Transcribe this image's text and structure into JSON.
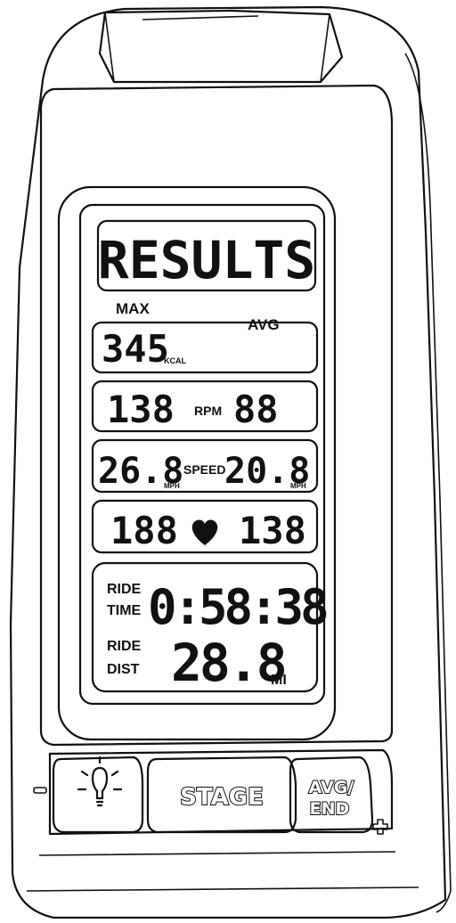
{
  "display": {
    "title": "RESULTS",
    "col_max": "MAX",
    "col_avg": "AVG",
    "calories": {
      "max": "345",
      "unit": "KCAL",
      "avg": ""
    },
    "rpm": {
      "max": "138",
      "label": "RPM",
      "avg": "88"
    },
    "speed": {
      "max": "26.8",
      "max_unit": "MPH",
      "label": "SPEED",
      "avg": "20.8",
      "avg_unit": "MPH"
    },
    "heart": {
      "max": "188",
      "icon": "heart-icon",
      "avg": "138"
    },
    "ride_time": {
      "label_line1": "RIDE",
      "label_line2": "TIME",
      "value": "0:58:38"
    },
    "ride_dist": {
      "label_line1": "RIDE",
      "label_line2": "DIST",
      "value": "28.8",
      "unit": "MI"
    }
  },
  "buttons": {
    "light": {
      "icon": "lightbulb-icon"
    },
    "stage": {
      "label": "STAGE"
    },
    "avg_end": {
      "label_line1": "AVG/",
      "label_line2": "END"
    },
    "minus": {
      "icon": "minus-icon"
    },
    "plus": {
      "icon": "plus-icon"
    }
  }
}
